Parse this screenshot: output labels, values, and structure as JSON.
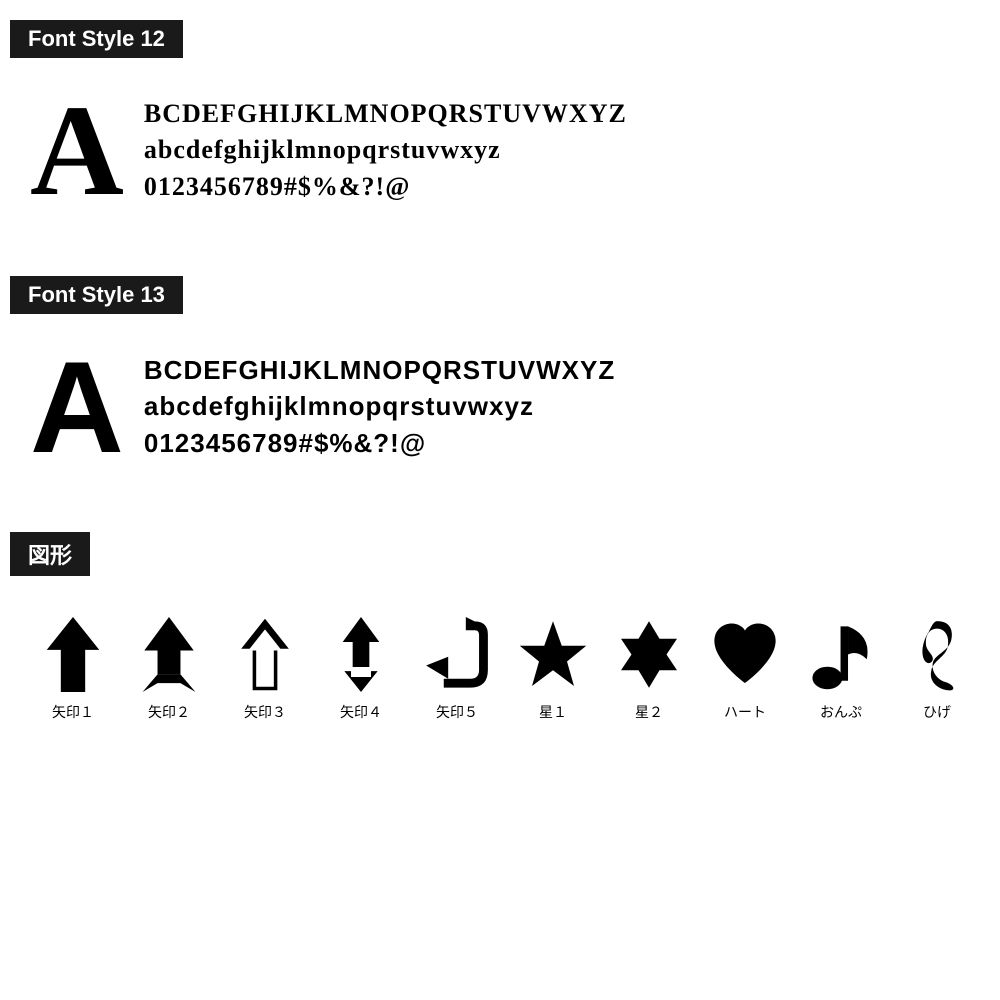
{
  "font_style_12": {
    "label": "Font Style 12",
    "big_letter": "A",
    "rows": [
      "BCDEFGHIJKLMNOPQRSTUVWXYZ",
      "abcdefghijklmnopqrstuvwxyz",
      "0123456789#$%&?!@"
    ]
  },
  "font_style_13": {
    "label": "Font Style 13",
    "big_letter": "A",
    "rows": [
      "BCDEFGHIJKLMNOPQRSTUVWXYZ",
      "abcdefghijklmnopqrstuvwxyz",
      "0123456789#$%&?!@"
    ]
  },
  "shapes_section": {
    "label": "図形",
    "shapes": [
      {
        "name": "yajirushi1",
        "label": "矢印１"
      },
      {
        "name": "yajirushi2",
        "label": "矢印２"
      },
      {
        "name": "yajirushi3",
        "label": "矢印３"
      },
      {
        "name": "yajirushi4",
        "label": "矢印４"
      },
      {
        "name": "yajirushi5",
        "label": "矢印５"
      },
      {
        "name": "hoshi1",
        "label": "星１"
      },
      {
        "name": "hoshi2",
        "label": "星２"
      },
      {
        "name": "heart",
        "label": "ハート"
      },
      {
        "name": "onpu",
        "label": "おんぷ"
      },
      {
        "name": "hige",
        "label": "ひげ"
      }
    ]
  }
}
